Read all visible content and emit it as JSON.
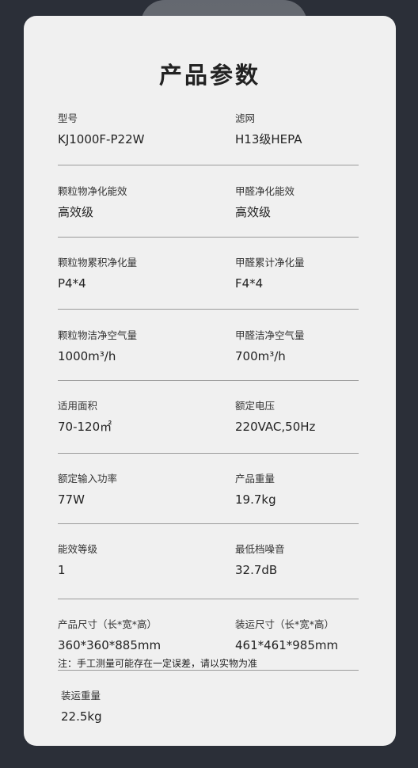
{
  "title": "产品参数",
  "params": [
    {
      "left": {
        "label": "型号",
        "value": "KJ1000F-P22W"
      },
      "right": {
        "label": "滤网",
        "value": "H13级HEPA"
      }
    },
    {
      "left": {
        "label": "颗粒物净化能效",
        "value": "高效级"
      },
      "right": {
        "label": "甲醛净化能效",
        "value": "高效级"
      }
    },
    {
      "left": {
        "label": "颗粒物累积净化量",
        "value": "P4*4"
      },
      "right": {
        "label": "甲醛累计净化量",
        "value": "F4*4"
      }
    },
    {
      "left": {
        "label": "颗粒物洁净空气量",
        "value": "1000m³/h"
      },
      "right": {
        "label": "甲醛洁净空气量",
        "value": "700m³/h"
      }
    },
    {
      "left": {
        "label": "适用面积",
        "value": "70-120㎡"
      },
      "right": {
        "label": "额定电压",
        "value": "220VAC,50Hz"
      }
    },
    {
      "left": {
        "label": "额定输入功率",
        "value": "77W"
      },
      "right": {
        "label": "产品重量",
        "value": "19.7kg"
      }
    },
    {
      "left": {
        "label": "能效等级",
        "value": "1"
      },
      "right": {
        "label": "最低档噪音",
        "value": "32.7dB"
      }
    },
    {
      "left": {
        "label": "产品尺寸（长*宽*高）",
        "value": "360*360*885mm"
      },
      "right": {
        "label": "装运尺寸（长*宽*高）",
        "value": "461*461*985mm"
      }
    }
  ],
  "note": "注：手工测量可能存在一定误差，请以实物为准",
  "shipping_weight": {
    "label": "装运重量",
    "value": "22.5kg"
  }
}
